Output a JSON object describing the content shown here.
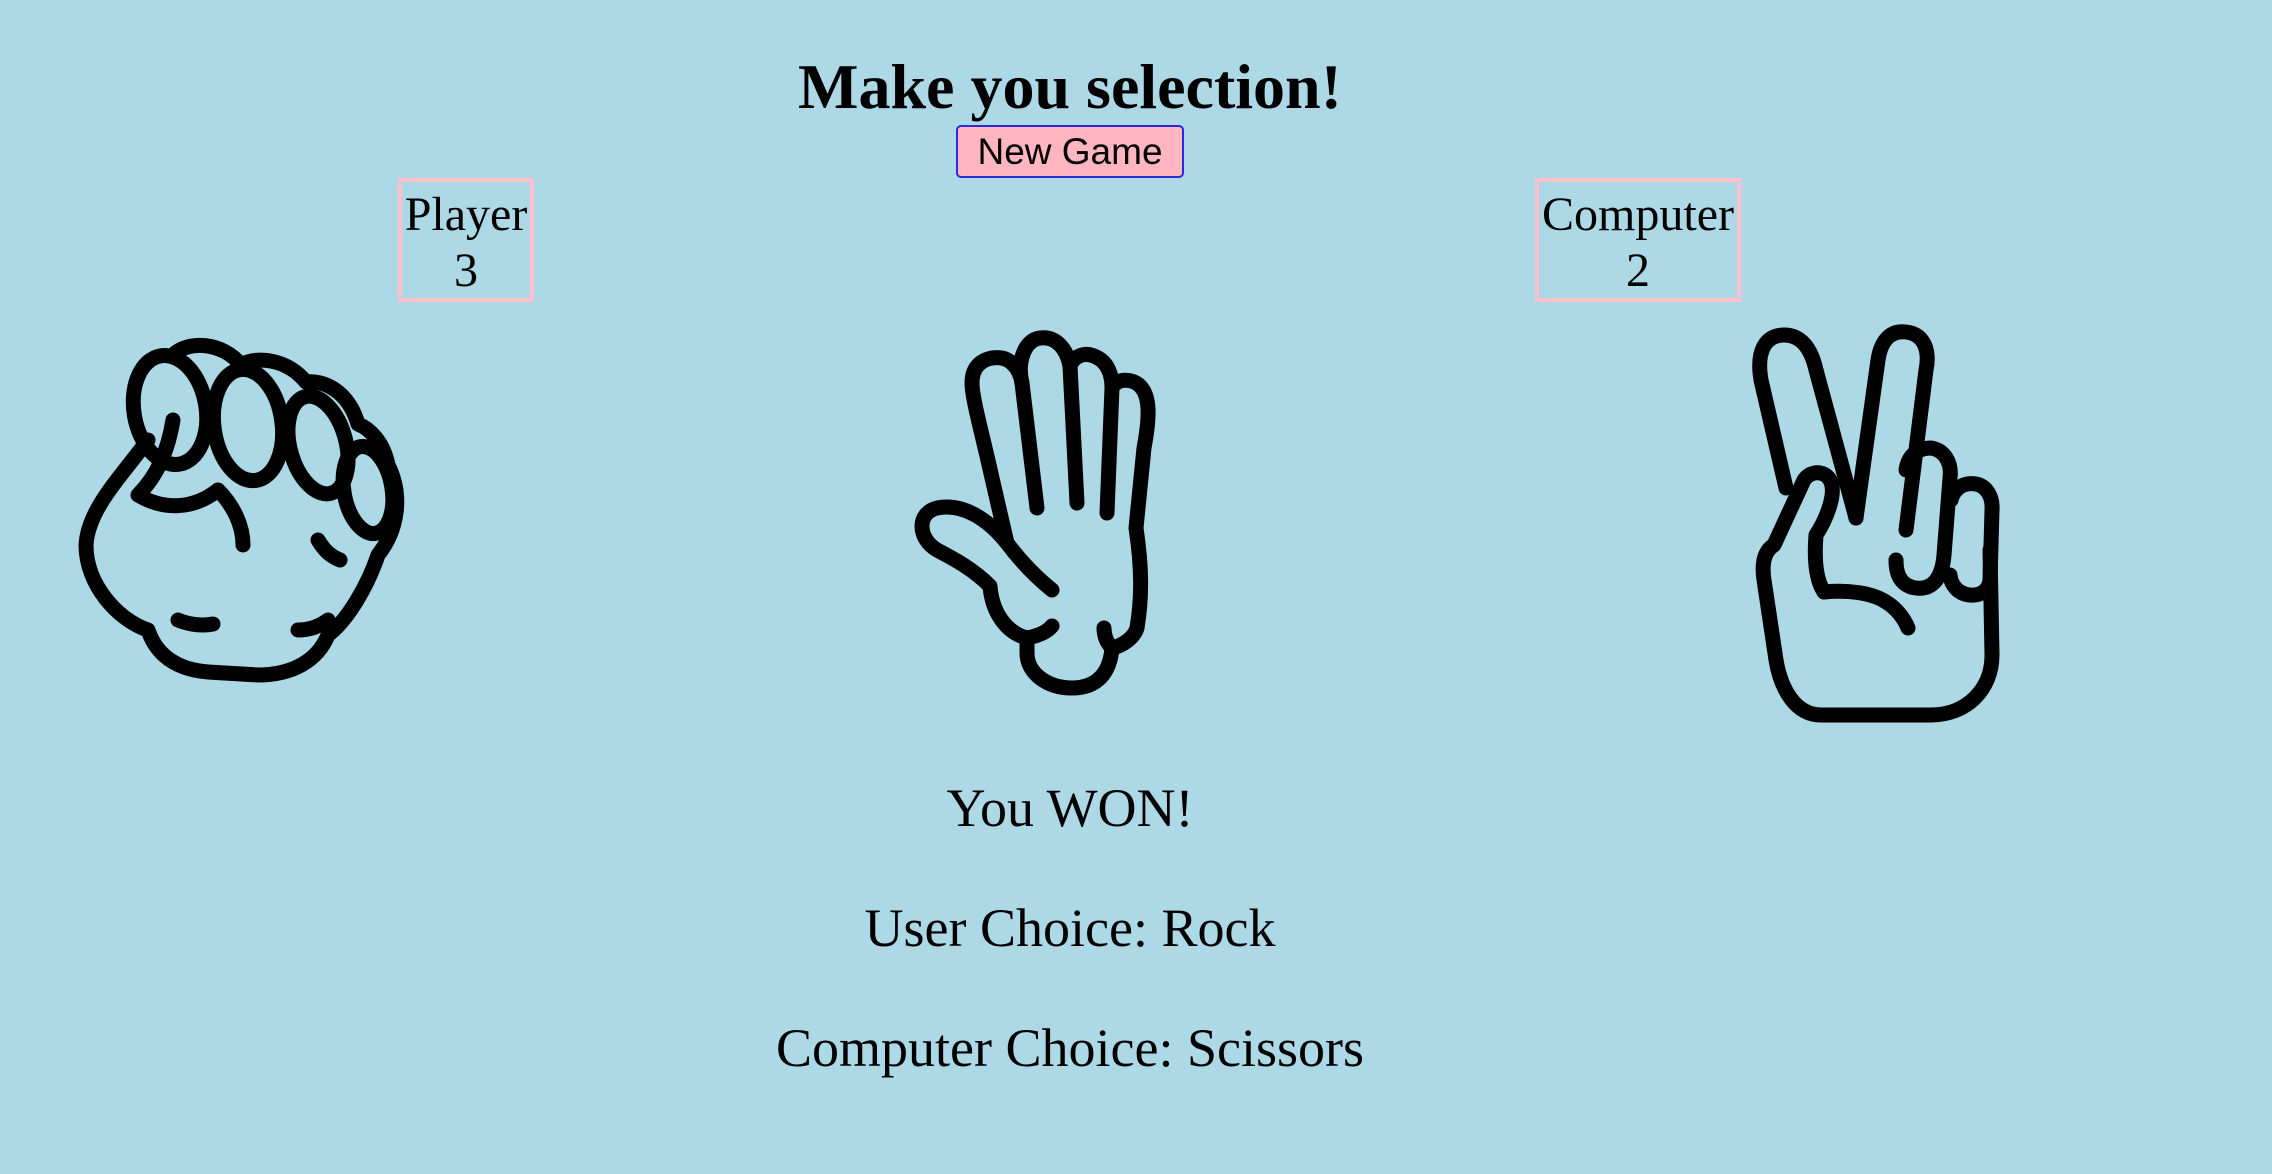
{
  "title": "Make you selection!",
  "new_game_label": "New Game",
  "player": {
    "label": "Player",
    "score": "3"
  },
  "computer": {
    "label": "Computer",
    "score": "2"
  },
  "choices": [
    {
      "name": "Rock",
      "icon": "rock-hand-icon"
    },
    {
      "name": "Paper",
      "icon": "paper-hand-icon"
    },
    {
      "name": "Scissors",
      "icon": "scissors-hand-icon"
    }
  ],
  "result": {
    "outcome": "You WON!",
    "user_choice": "User Choice: Rock",
    "computer_choice": "Computer Choice: Scissors"
  },
  "colors": {
    "background": "#add8e6",
    "button_fill": "#ffb6c1",
    "button_border": "#2a2ad8",
    "score_border": "#ffc0cb"
  }
}
